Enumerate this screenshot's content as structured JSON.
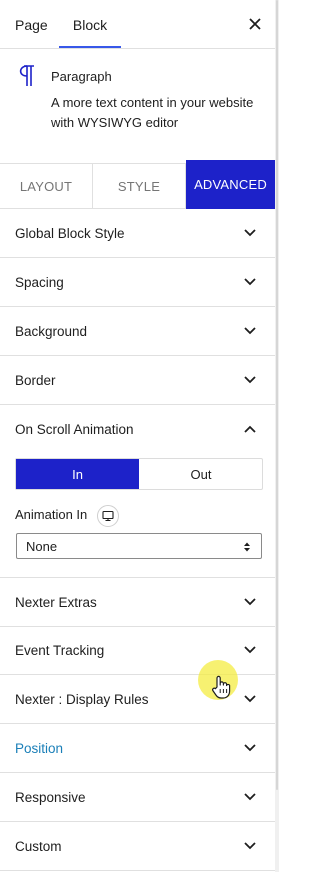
{
  "top_tabs": {
    "page": "Page",
    "block": "Block"
  },
  "block_card": {
    "icon": "paragraph-icon",
    "title": "Paragraph",
    "description": "A more text content in your website with WYSIWYG editor"
  },
  "style_tabs": {
    "layout": "LAYOUT",
    "style": "STYLE",
    "advanced": "ADVANCED"
  },
  "sections": {
    "global_block_style": "Global Block Style",
    "spacing": "Spacing",
    "background": "Background",
    "border": "Border",
    "on_scroll_animation": "On Scroll Animation",
    "nexter_extras": "Nexter Extras",
    "event_tracking": "Event Tracking",
    "display_rules": "Nexter : Display Rules",
    "position": "Position",
    "responsive": "Responsive",
    "custom": "Custom"
  },
  "on_scroll_animation": {
    "toggle": {
      "in": "In",
      "out": "Out",
      "selected": "In"
    },
    "animation_in_label": "Animation In",
    "animation_in_value": "None"
  },
  "colors": {
    "accent": "#1d22c9",
    "tab_underline": "#3858e9",
    "link": "#1a7fb8",
    "cursor_highlight": "#f4ec42"
  }
}
